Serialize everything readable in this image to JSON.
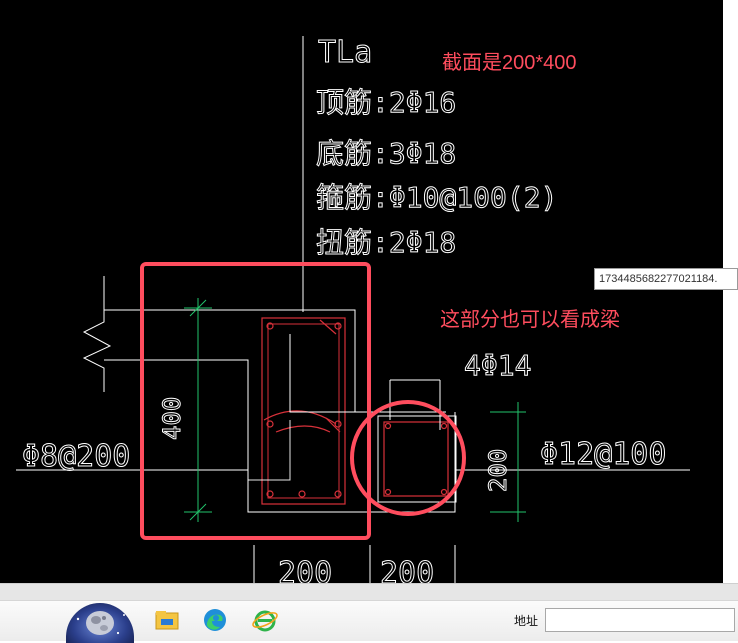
{
  "drawing": {
    "beam_id": "TLa",
    "top_bar": "顶筋:2Φ16",
    "bottom_bar": "底筋:3Φ18",
    "stirrup": "箍筋:Φ10@100(2)",
    "torsion_bar": "扭筋:2Φ18",
    "left_dim": "400",
    "left_stirrup": "Φ8@200",
    "right_top_bar": "4Φ14",
    "right_stirrup": "Φ12@100",
    "right_dim": "200",
    "bottom_dim_left": "200",
    "bottom_dim_right": "200"
  },
  "annotations": {
    "section_note": "截面是200*400",
    "beam_note": "这部分也可以看成梁",
    "color": "#ff4d5e"
  },
  "tooltip": {
    "text": "1734485682277021184."
  },
  "taskbar": {
    "address_label": "地址",
    "address_value": "",
    "icons": [
      "start-orb-icon",
      "file-explorer-icon",
      "edge-browser-icon",
      "ie-browser-icon"
    ]
  }
}
